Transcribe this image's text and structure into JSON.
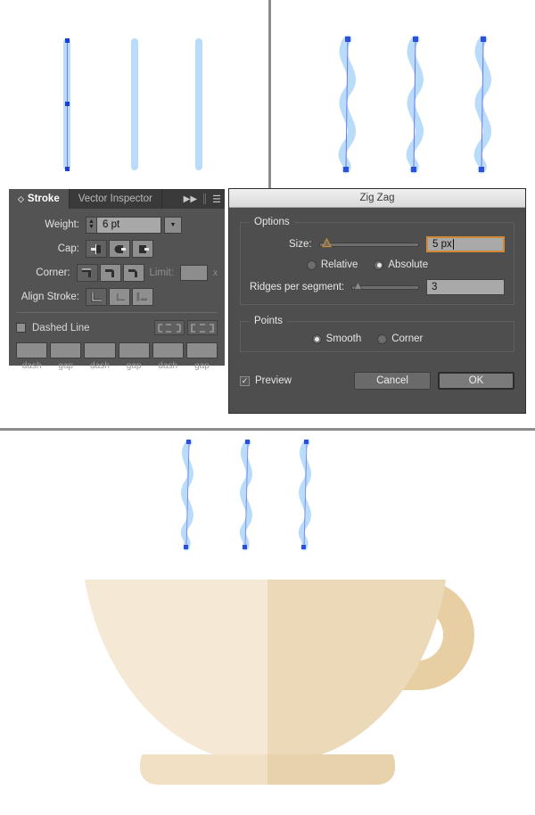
{
  "app": {
    "context": "Adobe Illustrator vector editing — Stroke panel and Zig Zag effect dialog over coffee-cup steam artwork"
  },
  "stroke_panel": {
    "tabs": [
      {
        "label": "Stroke",
        "active": true,
        "icon": "diamond-icon"
      },
      {
        "label": "Vector Inspector",
        "active": false
      }
    ],
    "header_icons": [
      "double-chevron-right-icon",
      "panel-menu-icon"
    ],
    "weight": {
      "label": "Weight:",
      "value": "6 pt",
      "stepper": "stepper-icon",
      "dropdown": "chevron-down-icon"
    },
    "cap": {
      "label": "Cap:",
      "options": [
        "butt-cap-icon",
        "round-cap-icon",
        "projecting-cap-icon"
      ],
      "selected_index": 0
    },
    "corner": {
      "label": "Corner:",
      "options": [
        "miter-join-icon",
        "round-join-icon",
        "bevel-join-icon"
      ],
      "selected_index": 0,
      "limit_label": "Limit:",
      "limit_value": "",
      "limit_suffix": "x"
    },
    "align_stroke": {
      "label": "Align Stroke:",
      "options": [
        "align-center-icon",
        "align-inside-icon",
        "align-outside-icon"
      ],
      "selected_index": 0
    },
    "dashed_line": {
      "label": "Dashed Line",
      "checked": false,
      "dash_buttons": [
        "dash-preserve-icon",
        "dash-align-icon"
      ],
      "fields": [
        "",
        "",
        "",
        "",
        "",
        ""
      ],
      "field_captions": [
        "dash",
        "gap",
        "dash",
        "gap",
        "dash",
        "gap"
      ]
    }
  },
  "zigzag_dialog": {
    "title": "Zig Zag",
    "options_group": {
      "legend": "Options",
      "size": {
        "label": "Size:",
        "value": "5 px",
        "slider_percent": 4,
        "focused": true
      },
      "mode": {
        "options": [
          "Relative",
          "Absolute"
        ],
        "selected": "Absolute"
      },
      "ridges": {
        "label": "Ridges per segment:",
        "value": "3",
        "slider_percent": 3
      }
    },
    "points_group": {
      "legend": "Points",
      "options": [
        "Smooth",
        "Corner"
      ],
      "selected": "Smooth"
    },
    "preview": {
      "label": "Preview",
      "checked": true,
      "mark": "✓"
    },
    "buttons": {
      "cancel": "Cancel",
      "ok": "OK"
    }
  },
  "artwork": {
    "straight_lines": {
      "count": 3,
      "color": "#b9dcfb",
      "selected_index": 0,
      "anchor_color": "#1a3fd4"
    },
    "wavy_lines_top": {
      "count": 3,
      "color": "#b9dcfb",
      "anchor_color": "#2b50e0"
    },
    "steam_lines_cup": {
      "count": 3,
      "color": "#b9dcfb",
      "anchor_color": "#2b50e0"
    },
    "cup": {
      "body_left_color": "#f5e8d5",
      "body_right_color": "#ecd9b8",
      "handle_color": "#e8cfa3",
      "saucer_left_color": "#f1e0c4",
      "saucer_right_color": "#e8d2ab"
    }
  }
}
